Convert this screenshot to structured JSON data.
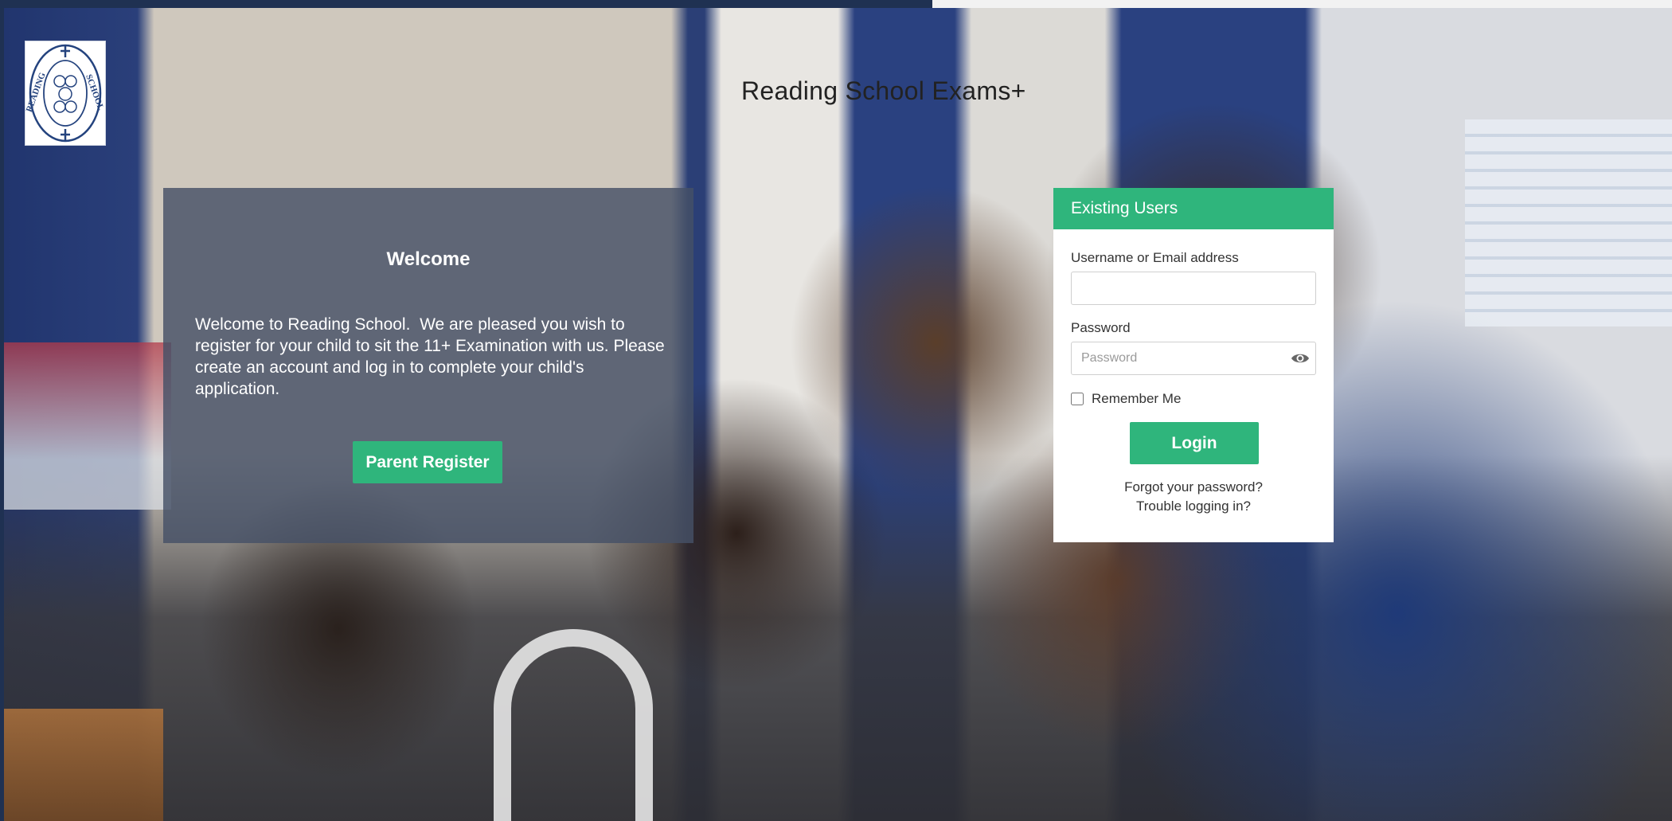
{
  "site": {
    "title": "Reading School Exams+",
    "logo_icon": "reading-school-crest-icon",
    "logo_text_left": "READING",
    "logo_text_right": "SCHOOL"
  },
  "welcome": {
    "title": "Welcome",
    "body": "Welcome to Reading School.  We are pleased you wish to register for your child to sit the 11+ Examination with us. Please create an account and log in to complete your child's application.",
    "register_label": "Parent Register"
  },
  "login": {
    "header": "Existing Users",
    "username_label": "Username or Email address",
    "username_value": "",
    "password_label": "Password",
    "password_placeholder": "Password",
    "password_value": "",
    "password_toggle_icon": "eye-icon",
    "remember_label": "Remember Me",
    "remember_checked": false,
    "login_label": "Login",
    "forgot_link": "Forgot your password?",
    "trouble_link": "Trouble logging in?"
  },
  "colors": {
    "accent_green": "#2fb57c",
    "panel_overlay": "#465066",
    "frame_navy": "#1f3152",
    "crest_blue": "#24437e"
  }
}
